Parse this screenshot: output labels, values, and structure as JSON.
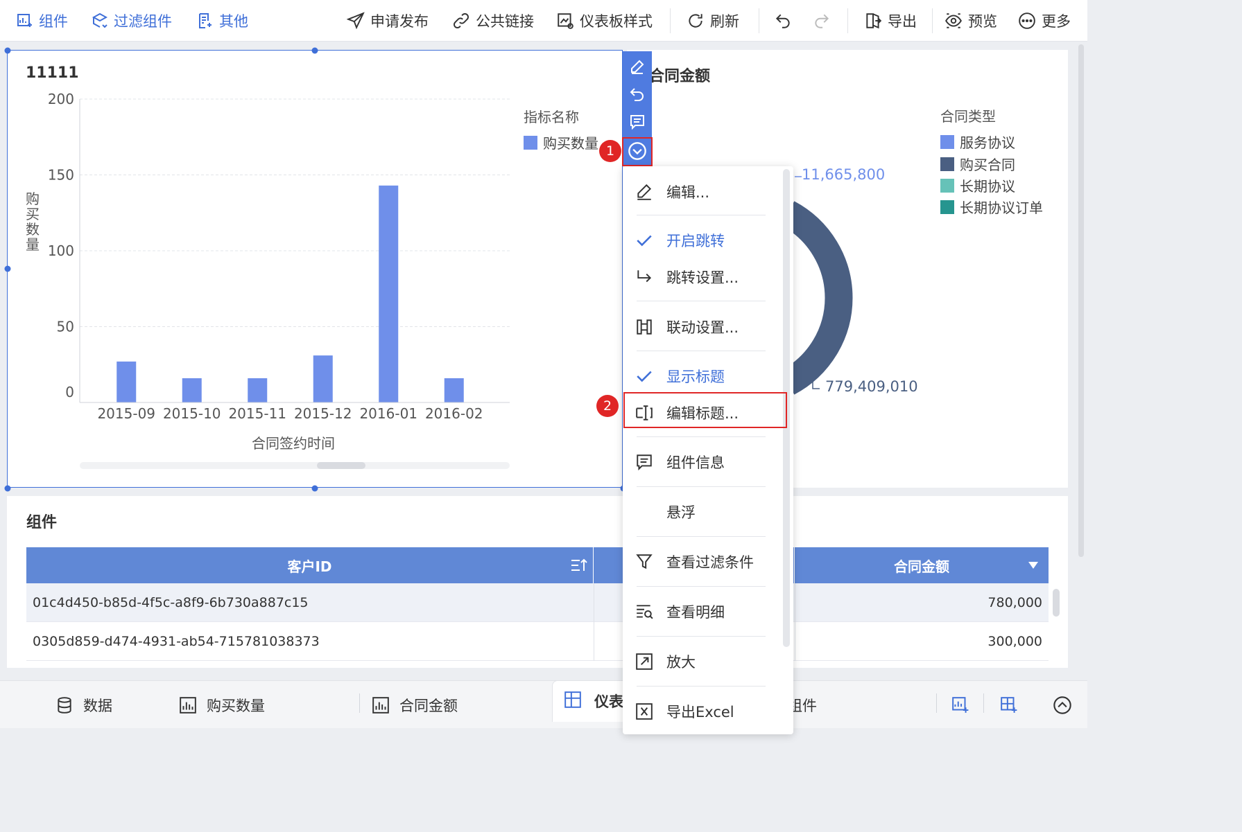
{
  "toolbar": {
    "left": [
      {
        "label": "组件",
        "icon": "add-component-icon"
      },
      {
        "label": "过滤组件",
        "icon": "filter-component-icon"
      },
      {
        "label": "其他",
        "icon": "other-icon"
      }
    ],
    "right": {
      "publish": "申请发布",
      "public_link": "公共链接",
      "dashboard_style": "仪表板样式",
      "refresh": "刷新",
      "export": "导出",
      "preview": "预览",
      "more": "更多"
    }
  },
  "bar_chart": {
    "title": "11111",
    "legend_title": "指标名称",
    "legend_items": [
      {
        "name": "购买数量",
        "color": "#6f8fea"
      }
    ]
  },
  "chart_data": {
    "type": "bar",
    "categories": [
      "2015-09",
      "2015-10",
      "2015-11",
      "2015-12",
      "2016-01",
      "2016-02"
    ],
    "values": [
      27,
      16,
      16,
      31,
      143,
      16
    ],
    "ylim": [
      0,
      200
    ],
    "yticks": [
      "200",
      "150",
      "100",
      "50",
      "0"
    ],
    "xlabel": "合同签约时间",
    "ylabel": "购买数量",
    "color": "#6f8fea",
    "grid": true
  },
  "donut_chart": {
    "title": "合同金额",
    "legend_title": "合同类型",
    "legend_items": [
      {
        "name": "服务协议",
        "color": "#6f8fea"
      },
      {
        "name": "购买合同",
        "color": "#4a5f82"
      },
      {
        "name": "长期协议",
        "color": "#66c2b8"
      },
      {
        "name": "长期协议订单",
        "color": "#26958f"
      }
    ],
    "label_top": "11,665,800",
    "label_bottom": "779,409,010",
    "main_color": "#4a5f82",
    "top_label_color": "#6f8fea"
  },
  "action_bar": {
    "icons": [
      "edit-icon",
      "undo-icon",
      "comment-icon",
      "chevron-down-circle-icon"
    ]
  },
  "steps": {
    "one": "1",
    "two": "2"
  },
  "context_menu": {
    "items": [
      {
        "label": "编辑...",
        "icon": "edit-icon",
        "checked": false
      },
      {
        "label": "开启跳转",
        "icon": "check-icon",
        "checked": true
      },
      {
        "label": "跳转设置...",
        "icon": "jump-arrow-icon",
        "checked": false
      },
      {
        "label": "联动设置...",
        "icon": "link-settings-icon",
        "checked": false
      },
      {
        "label": "显示标题",
        "icon": "check-icon",
        "checked": true
      },
      {
        "label": "编辑标题...",
        "icon": "edit-title-icon",
        "checked": false
      },
      {
        "label": "组件信息",
        "icon": "info-icon",
        "checked": false
      },
      {
        "label": "悬浮",
        "icon": "",
        "checked": false
      },
      {
        "label": "查看过滤条件",
        "icon": "filter-icon",
        "checked": false
      },
      {
        "label": "查看明细",
        "icon": "detail-icon",
        "checked": false
      },
      {
        "label": "放大",
        "icon": "enlarge-icon",
        "checked": false
      },
      {
        "label": "导出Excel",
        "icon": "export-excel-icon",
        "checked": false
      }
    ]
  },
  "table_card": {
    "title": "组件",
    "columns": [
      "客户ID",
      "合同金额"
    ],
    "rows": [
      [
        "01c4d450-b85d-4f5c-a8f9-6b730a887c15",
        "780,000"
      ],
      [
        "0305d859-d474-4931-ab54-715781038373",
        "300,000"
      ]
    ]
  },
  "bottom_tabs": {
    "data": "数据",
    "purchase_qty": "购买数量",
    "contract_amount": "合同金额",
    "dashboard": "仪表",
    "component": "组件"
  }
}
